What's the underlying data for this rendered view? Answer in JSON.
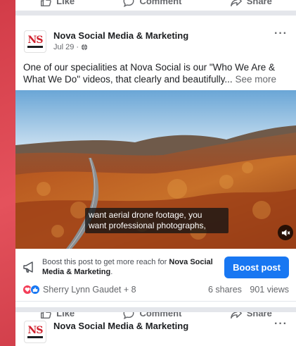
{
  "actions": {
    "like": "Like",
    "comment": "Comment",
    "share": "Share"
  },
  "post": {
    "page_name": "Nova Social Media & Marketing",
    "logo_text": "NS",
    "date": "Jul 29 · ",
    "more": "···",
    "text": "One of our specialities at Nova Social is our \"Who We Are & What We Do\" videos, that clearly and beautifully... ",
    "see_more": "See more",
    "caption_line1": "want aerial drone footage, you",
    "caption_line2": "want professional photographs,"
  },
  "boost": {
    "text_prefix": "Boost this post to get more reach for ",
    "text_page": "Nova Social Media & Marketing",
    "text_suffix": ".",
    "button": "Boost post"
  },
  "stats": {
    "reactors": "Sherry Lynn Gaudet + 8",
    "shares": "6 shares",
    "views": "901 views"
  },
  "next_post": {
    "page_name": "Nova Social Media & Marketing",
    "logo_text": "NS",
    "more": "···"
  },
  "colors": {
    "accent": "#1877f2",
    "background": "#d23c48",
    "love": "#f33e58"
  }
}
